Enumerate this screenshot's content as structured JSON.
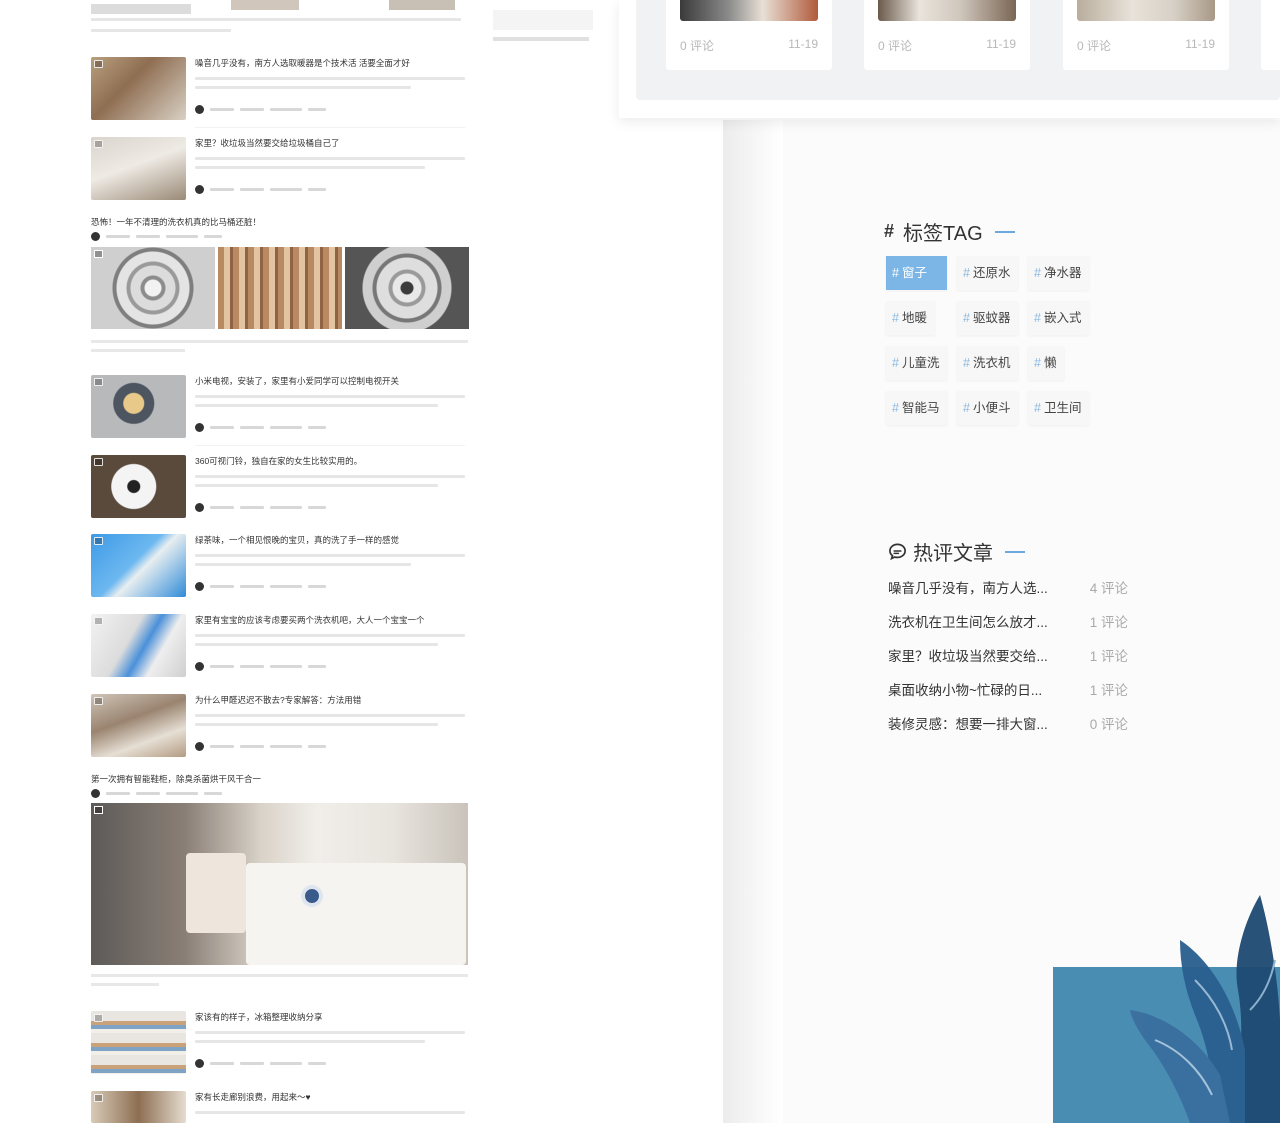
{
  "articles": [
    {
      "title": "噪音几乎没有，南方人选取暖器是个技术活 活要全面才好"
    },
    {
      "title": "家里？收垃圾当然要交给垃圾桶自己了"
    },
    {
      "title": "小米电视，安装了，家里有小爱同学可以控制电视开关"
    },
    {
      "title": "360可视门铃，独自在家的女生比较实用的。"
    },
    {
      "title": "绿茶味，一个相见恨晚的宝贝，真的洗了手一样的感觉"
    },
    {
      "title": "家里有宝宝的应该考虑要买两个洗衣机吧，大人一个宝宝一个"
    },
    {
      "title": "为什么甲醛迟迟不散去?专家解答：方法用错"
    },
    {
      "title": "家该有的样子，冰箱整理收纳分享"
    },
    {
      "title": "家有长走廊别浪费，用起来～♥"
    }
  ],
  "gallery_post": {
    "title": "恐怖！一年不清理的洗衣机真的比马桶还脏！"
  },
  "big_post": {
    "title": "第一次拥有智能鞋柜，除臭杀菌烘干风干合一"
  },
  "top_cards": [
    {
      "comments": "0 评论",
      "date": "11-19"
    },
    {
      "comments": "0 评论",
      "date": "11-19"
    },
    {
      "comments": "0 评论",
      "date": "11-19"
    }
  ],
  "tag_widget": {
    "hash": "#",
    "title": "标签TAG",
    "tags": [
      "窗子",
      "还原水",
      "净水器",
      "地暖",
      "驱蚊器",
      "嵌入式",
      "儿童洗",
      "洗衣机",
      "懒",
      "智能马",
      "小便斗",
      "卫生间"
    ]
  },
  "hot_widget": {
    "title": "热评文章",
    "items": [
      {
        "title": "噪音几乎没有，南方人选...",
        "comments": "4 评论"
      },
      {
        "title": "洗衣机在卫生间怎么放才...",
        "comments": "1 评论"
      },
      {
        "title": "家里？收垃圾当然要交给...",
        "comments": "1 评论"
      },
      {
        "title": "桌面收纳小物~忙碌的日...",
        "comments": "1 评论"
      },
      {
        "title": "装修灵感：想要一排大窗...",
        "comments": "0 评论"
      }
    ]
  },
  "colors": {
    "accent": "#7cb6e6",
    "tag_hash": "#8ab8e0",
    "deco_blue": "#4a8db3"
  },
  "icons": {
    "hot": "chat-bubble-icon",
    "image_badge": "image-icon",
    "avatar": "avatar-icon"
  }
}
